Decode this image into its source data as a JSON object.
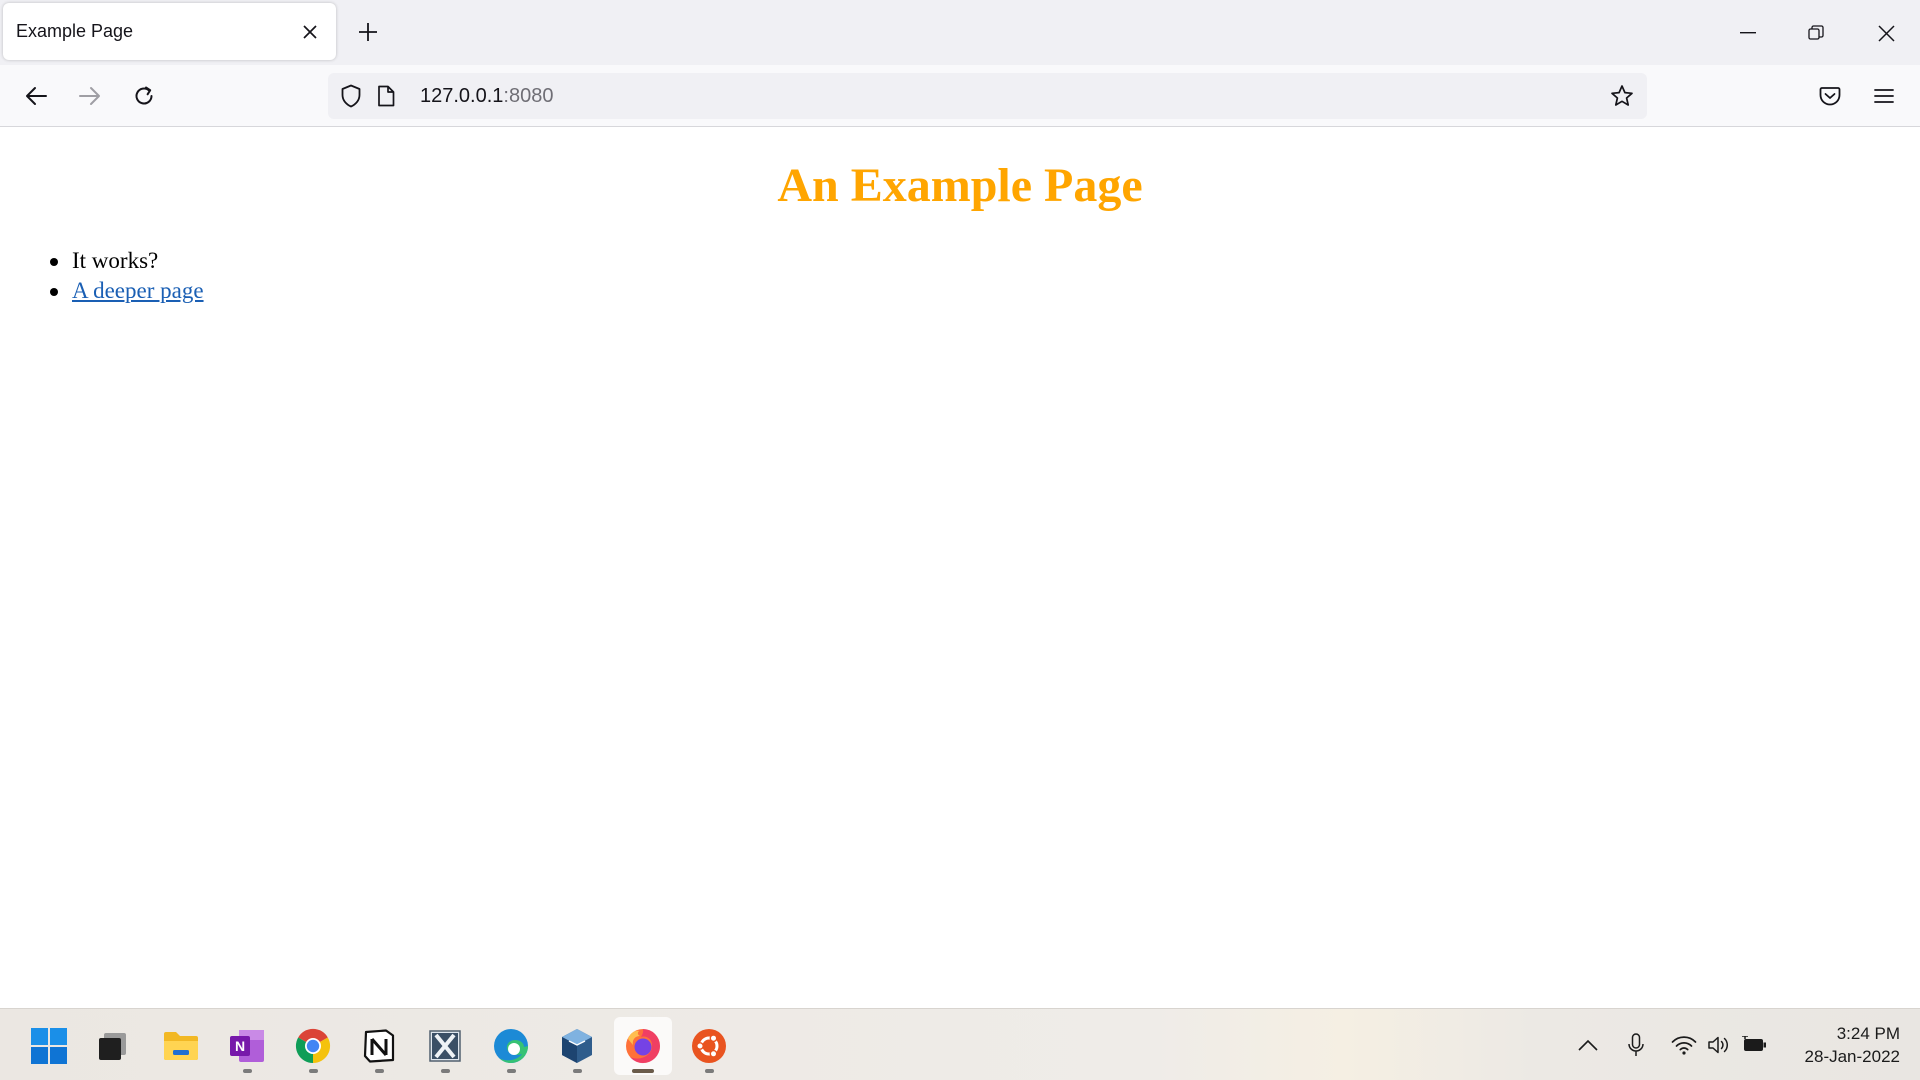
{
  "browser": {
    "tab": {
      "title": "Example Page"
    },
    "url": {
      "host": "127.0.0.1",
      "port": ":8080"
    }
  },
  "page": {
    "heading": "An Example Page",
    "heading_color": "#ffa500",
    "items": [
      {
        "text": "It works?",
        "is_link": false
      },
      {
        "text": "A deeper page",
        "is_link": true
      }
    ]
  },
  "taskbar": {
    "apps": [
      "start-icon",
      "task-view-icon",
      "file-explorer-icon",
      "onenote-icon",
      "chrome-icon",
      "notion-icon",
      "xming-icon",
      "edge-icon",
      "virtualbox-icon",
      "firefox-icon",
      "ubuntu-icon"
    ],
    "active_app": "firefox-icon",
    "tray": [
      "chevron-up-icon",
      "microphone-icon",
      "wifi-icon",
      "volume-icon",
      "battery-icon"
    ],
    "clock": {
      "time": "3:24 PM",
      "date": "28-Jan-2022"
    }
  }
}
